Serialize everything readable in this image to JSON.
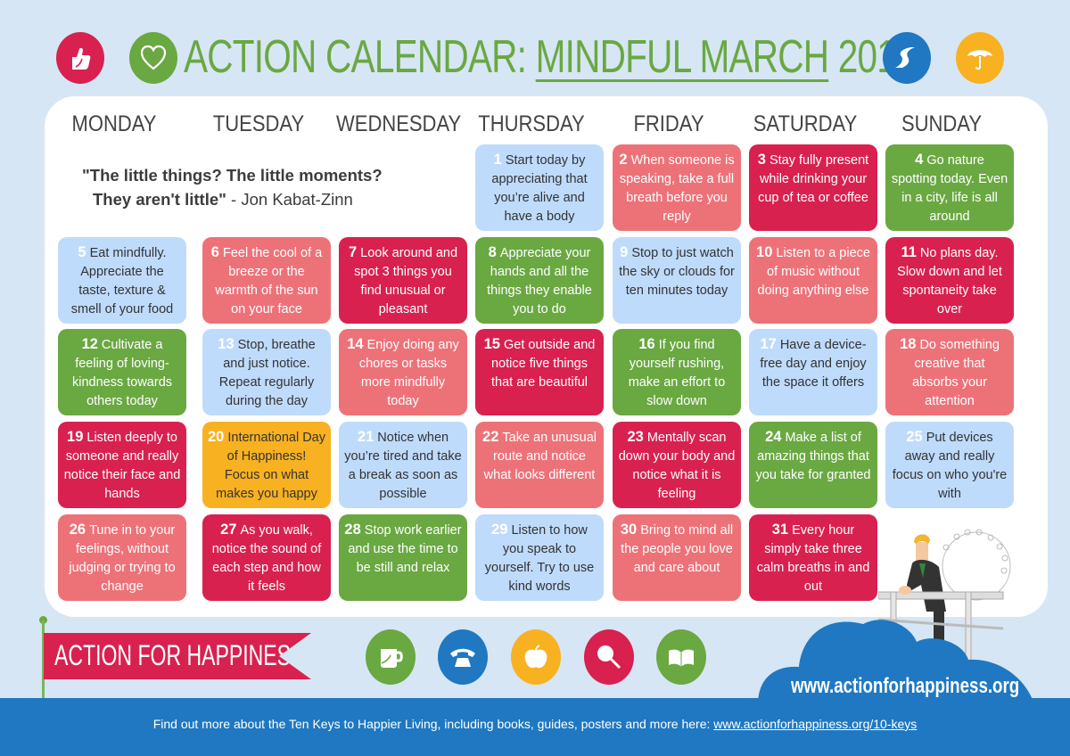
{
  "header": {
    "title_prefix": "ACTION CALENDAR: ",
    "title_underlined": "MINDFUL MARCH",
    "title_suffix": " 2018",
    "icons_left": [
      "thumbs-up-icon",
      "heart-icon"
    ],
    "icons_right": [
      "winding-road-icon",
      "umbrella-icon"
    ]
  },
  "weekdays": [
    "MONDAY",
    "TUESDAY",
    "WEDNESDAY",
    "THURSDAY",
    "FRIDAY",
    "SATURDAY",
    "SUNDAY"
  ],
  "quote": {
    "bold_line1": "\"The little things? The little moments?",
    "bold_line2": "They aren't little\"",
    "author": " - Jon Kabat-Zinn"
  },
  "days": [
    {
      "n": "1",
      "text": "Start today by appreciating that you’re alive and have a body",
      "color": "blue"
    },
    {
      "n": "2",
      "text": "When someone is speaking, take a full breath before you reply",
      "color": "pink"
    },
    {
      "n": "3",
      "text": "Stay fully present while drinking your cup of tea or coffee",
      "color": "red"
    },
    {
      "n": "4",
      "text": "Go nature spotting today. Even in a city, life is all around",
      "color": "green"
    },
    {
      "n": "5",
      "text": "Eat mindfully. Appreciate the taste, texture & smell of your food",
      "color": "blue"
    },
    {
      "n": "6",
      "text": "Feel the cool of a breeze or the warmth of the sun on your face",
      "color": "pink"
    },
    {
      "n": "7",
      "text": "Look around and spot 3 things you find unusual or pleasant",
      "color": "red"
    },
    {
      "n": "8",
      "text": "Appreciate your hands and all the things they enable you to do",
      "color": "green"
    },
    {
      "n": "9",
      "text": "Stop to just watch the sky or clouds for ten minutes today",
      "color": "blue"
    },
    {
      "n": "10",
      "text": "Listen to a piece of music without doing anything else",
      "color": "pink"
    },
    {
      "n": "11",
      "text": "No plans day. Slow down and let spontaneity take over",
      "color": "red"
    },
    {
      "n": "12",
      "text": "Cultivate a feeling of loving-kindness towards others today",
      "color": "green"
    },
    {
      "n": "13",
      "text": "Stop, breathe and just notice. Repeat regularly during the day",
      "color": "blue"
    },
    {
      "n": "14",
      "text": "Enjoy doing any chores or tasks more mindfully today",
      "color": "pink"
    },
    {
      "n": "15",
      "text": "Get outside and notice five things that are beautiful",
      "color": "red"
    },
    {
      "n": "16",
      "text": "If you find yourself rushing, make an effort to slow down",
      "color": "green"
    },
    {
      "n": "17",
      "text": "Have a device-free day and enjoy the space it offers",
      "color": "blue"
    },
    {
      "n": "18",
      "text": "Do something creative that absorbs your attention",
      "color": "pink"
    },
    {
      "n": "19",
      "text": "Listen deeply to someone and really notice their face and hands",
      "color": "red"
    },
    {
      "n": "20",
      "text": "International Day of Happiness! Focus on what makes you happy",
      "color": "orange"
    },
    {
      "n": "21",
      "text": "Notice when you’re tired and take a break as soon as possible",
      "color": "blue"
    },
    {
      "n": "22",
      "text": "Take an unusual route and notice what looks different",
      "color": "pink"
    },
    {
      "n": "23",
      "text": "Mentally scan down your body and notice what it is feeling",
      "color": "red"
    },
    {
      "n": "24",
      "text": "Make a list of amazing things that you take for granted",
      "color": "green"
    },
    {
      "n": "25",
      "text": "Put devices away and really focus on who you're with",
      "color": "blue"
    },
    {
      "n": "26",
      "text": "Tune in to your feelings, without judging or trying to change",
      "color": "pink"
    },
    {
      "n": "27",
      "text": "As you walk, notice the sound of each step and how it feels",
      "color": "red"
    },
    {
      "n": "28",
      "text": "Stop work earlier and use the time to be still and relax",
      "color": "green"
    },
    {
      "n": "29",
      "text": "Listen to how you speak to yourself. Try to use kind words",
      "color": "blue"
    },
    {
      "n": "30",
      "text": "Bring to mind all the people you love and care about",
      "color": "pink"
    },
    {
      "n": "31",
      "text": "Every hour simply take three calm breaths in and out",
      "color": "red"
    }
  ],
  "first_weekday_index": 3,
  "colors": {
    "blue": "#bfdbfb",
    "pink": "#ed7278",
    "red": "#d8214f",
    "green": "#6aa842",
    "orange": "#f8b121",
    "background": "#d7e6f4",
    "footer": "#1f78c1"
  },
  "brand": {
    "flag_label": "ACTION FOR HAPPINESS",
    "website": "www.actionforhappiness.org",
    "key_icons": [
      "mug-icon",
      "telephone-icon",
      "apple-icon",
      "magnifier-icon",
      "book-icon"
    ]
  },
  "footer": {
    "text": "Find out more about the Ten Keys to Happier Living, including books, guides, posters and more here: ",
    "link": "www.actionforhappiness.org/10-keys"
  }
}
